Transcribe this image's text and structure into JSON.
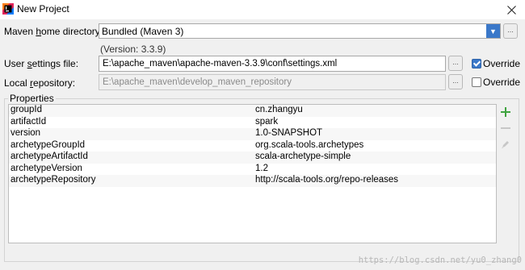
{
  "window": {
    "title": "New Project",
    "close_icon": "close-icon",
    "app_icon": "intellij-app-icon"
  },
  "maven_home": {
    "label_pre": "Maven ",
    "label_mnemonic": "h",
    "label_post": "ome directory:",
    "value": "Bundled (Maven 3)",
    "version_text": "(Version: 3.3.9)",
    "browse_label": "..."
  },
  "user_settings": {
    "label_pre": "User ",
    "label_mnemonic": "s",
    "label_post": "ettings file:",
    "value": "E:\\apache_maven\\apache-maven-3.3.9\\conf\\settings.xml",
    "browse_label": "...",
    "override_label": "Override",
    "override_checked": true
  },
  "local_repo": {
    "label_pre": "Local ",
    "label_mnemonic": "r",
    "label_post": "epository:",
    "value": "E:\\apache_maven\\develop_maven_repository",
    "browse_label": "...",
    "override_label": "Override",
    "override_checked": false
  },
  "properties": {
    "title": "Properties",
    "rows": [
      {
        "key": "groupId",
        "value": "cn.zhangyu"
      },
      {
        "key": "artifactId",
        "value": "spark"
      },
      {
        "key": "version",
        "value": "1.0-SNAPSHOT"
      },
      {
        "key": "archetypeGroupId",
        "value": "org.scala-tools.archetypes"
      },
      {
        "key": "archetypeArtifactId",
        "value": "scala-archetype-simple"
      },
      {
        "key": "archetypeVersion",
        "value": "1.2"
      },
      {
        "key": "archetypeRepository",
        "value": "http://scala-tools.org/repo-releases"
      }
    ],
    "add_icon": "plus-icon",
    "remove_icon": "minus-icon",
    "edit_icon": "pencil-icon"
  },
  "watermark": "https://blog.csdn.net/yu0_zhang0",
  "colors": {
    "accent": "#3a78c9",
    "add_green": "#3fa33f",
    "disabled_gray": "#c7c7c7"
  }
}
